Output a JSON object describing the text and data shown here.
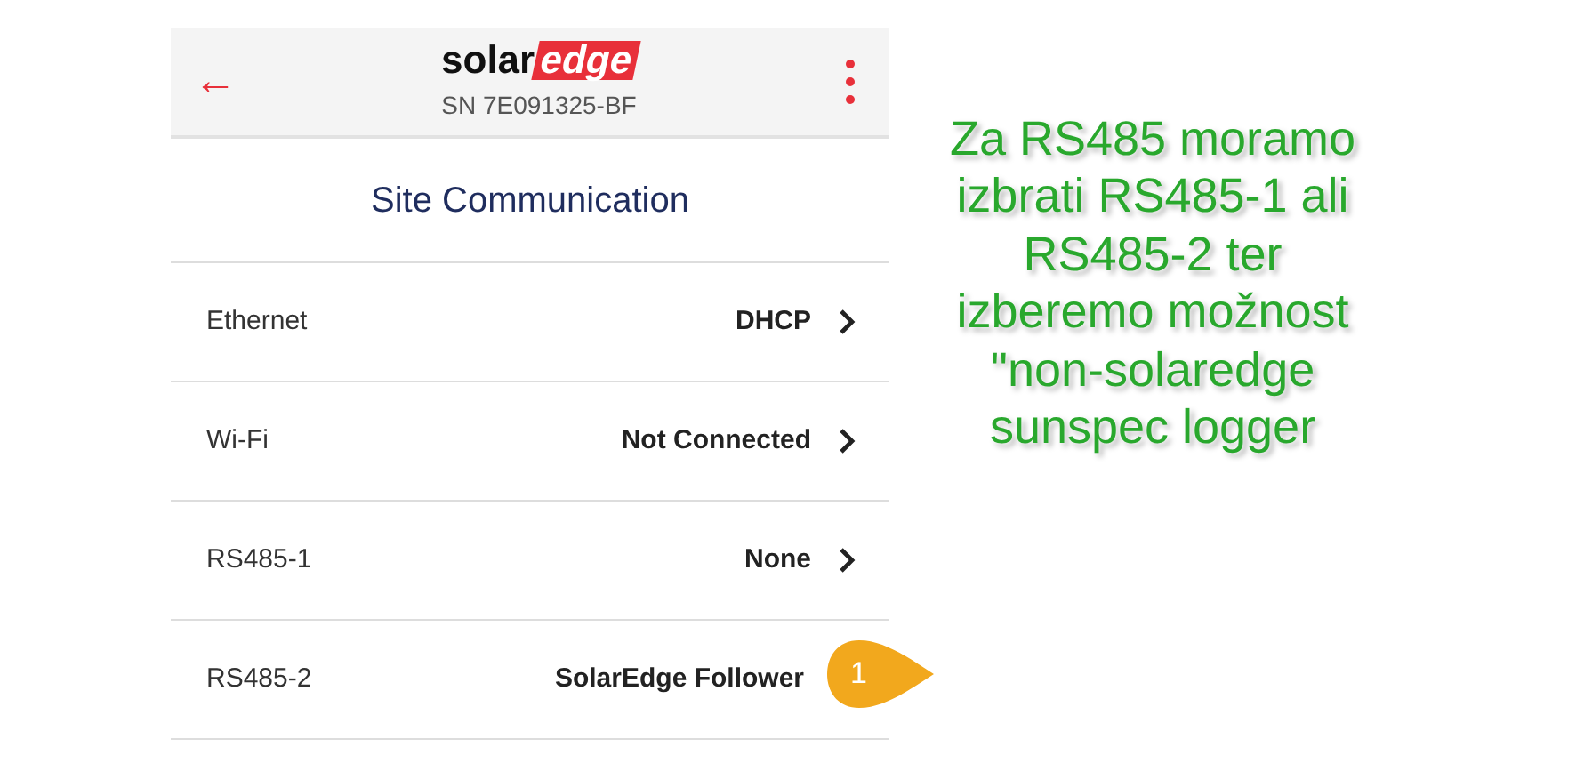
{
  "header": {
    "back_icon": "←",
    "logo": {
      "part_1": "solar",
      "part_2": "edge"
    },
    "serial": "SN 7E091325-BF"
  },
  "title": "Site Communication",
  "rows": [
    {
      "label": "Ethernet",
      "value": "DHCP",
      "chevron": true
    },
    {
      "label": "Wi-Fi",
      "value": "Not Connected",
      "chevron": true
    },
    {
      "label": "RS485-1",
      "value": "None",
      "chevron": true
    },
    {
      "label": "RS485-2",
      "value": "SolarEdge Follower",
      "chevron": false
    }
  ],
  "callout": {
    "number": "1"
  },
  "annotation": "Za RS485 moramo izbrati RS485-1 ali RS485-2 ter izberemo možnost \"non-solaredge sunspec logger"
}
